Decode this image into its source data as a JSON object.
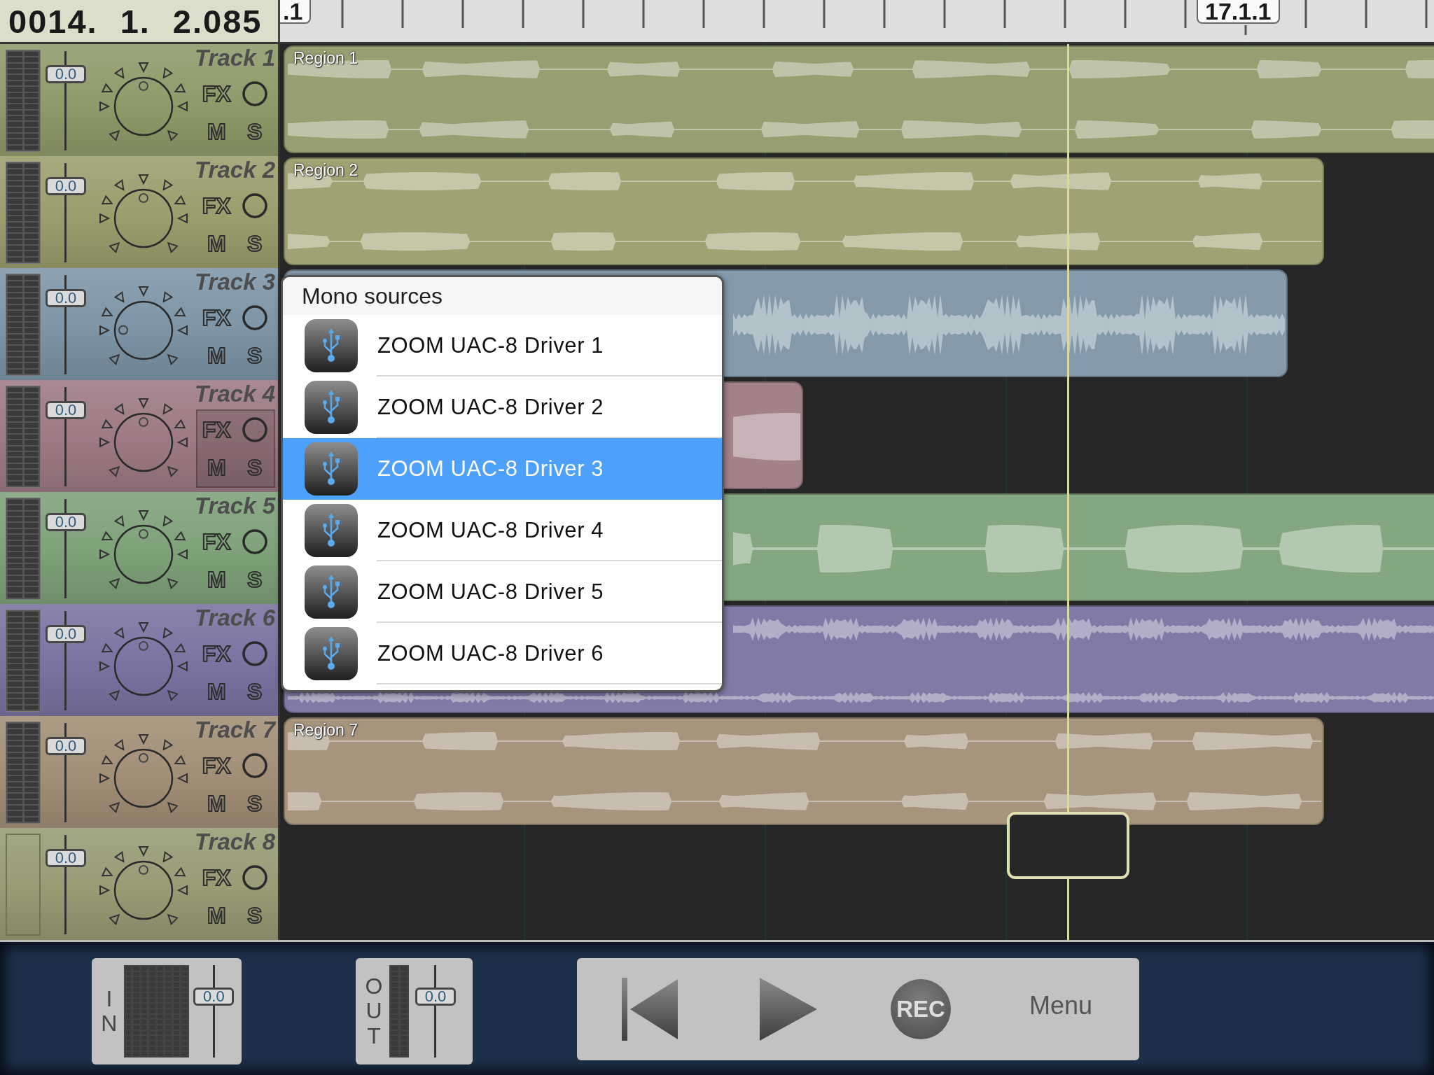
{
  "counter": {
    "fields": [
      "0014.",
      "1.",
      "2.085"
    ]
  },
  "ruler": {
    "markers": [
      ".1",
      "17.1.1"
    ]
  },
  "tracks": [
    {
      "name": "Track 1",
      "color": "#8f9a6a",
      "meter": true,
      "selected": false,
      "fader": "0.0",
      "pan": {
        "level": 0.5
      },
      "fx": "FX",
      "mute": "M",
      "solo": "S",
      "region": {
        "name": "Region 1",
        "kind": "stereo"
      }
    },
    {
      "name": "Track 2",
      "color": "#9c9d6d",
      "meter": true,
      "selected": false,
      "fader": "0.0",
      "pan": {
        "level": 0.5
      },
      "fx": "FX",
      "mute": "M",
      "solo": "S",
      "region": {
        "name": "Region 2",
        "kind": "stereo"
      }
    },
    {
      "name": "Track 3",
      "color": "#7d95a7",
      "meter": true,
      "selected": false,
      "fader": "0.0",
      "pan": {
        "level": 0.17
      },
      "fx": "FX",
      "mute": "M",
      "solo": "S",
      "region": {
        "kind": "mono"
      }
    },
    {
      "name": "Track 4",
      "color": "#9d7a83",
      "meter": true,
      "selected": true,
      "fader": "0.0",
      "pan": {
        "level": 0.5
      },
      "fx": "FX",
      "mute": "M",
      "solo": "S",
      "region": {
        "kind": "mono"
      }
    },
    {
      "name": "Track 5",
      "color": "#7ea179",
      "meter": true,
      "selected": false,
      "fader": "0.0",
      "pan": {
        "level": 0.5
      },
      "fx": "FX",
      "mute": "M",
      "solo": "S",
      "region": {
        "kind": "mono"
      }
    },
    {
      "name": "Track 6",
      "color": "#7a73a1",
      "meter": true,
      "selected": false,
      "fader": "0.0",
      "pan": {
        "level": 0.5
      },
      "fx": "FX",
      "mute": "M",
      "solo": "S",
      "region": {
        "kind": "stereo"
      }
    },
    {
      "name": "Track 7",
      "color": "#a18e76",
      "meter": true,
      "selected": false,
      "fader": "0.0",
      "pan": {
        "level": 0.5
      },
      "fx": "FX",
      "mute": "M",
      "solo": "S",
      "region": {
        "name": "Region 7",
        "kind": "stereo"
      }
    },
    {
      "name": "Track 8",
      "color": "#989b74",
      "meter": false,
      "selected": false,
      "fader": "0.0",
      "pan": {
        "level": 0.5
      },
      "fx": "FX",
      "mute": "M",
      "solo": "S"
    }
  ],
  "source_popup": {
    "title": "Mono sources",
    "items": [
      {
        "label": "ZOOM UAC-8 Driver 1",
        "selected": false
      },
      {
        "label": "ZOOM UAC-8 Driver 2",
        "selected": false
      },
      {
        "label": "ZOOM UAC-8 Driver 3",
        "selected": true
      },
      {
        "label": "ZOOM UAC-8 Driver 4",
        "selected": false
      },
      {
        "label": "ZOOM UAC-8 Driver 5",
        "selected": false
      },
      {
        "label": "ZOOM UAC-8 Driver 6",
        "selected": false
      }
    ]
  },
  "bottom_bar": {
    "input": {
      "label": "IN",
      "fader": "0.0"
    },
    "output": {
      "label": "OUT",
      "fader": "0.0"
    },
    "transport": {
      "rec": "REC",
      "menu": "Menu"
    }
  }
}
